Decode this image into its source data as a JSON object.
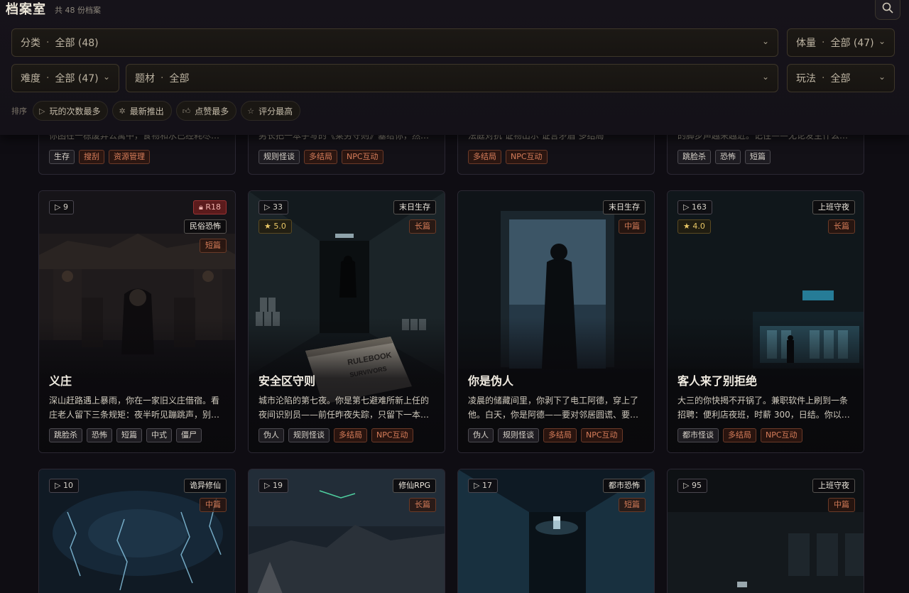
{
  "header": {
    "title": "档案室",
    "count": "共 48 份档案",
    "search_icon": "search-icon"
  },
  "filters": {
    "category": {
      "label": "分类",
      "value": "全部 (48)"
    },
    "volume": {
      "label": "体量",
      "value": "全部 (47)"
    },
    "difficulty": {
      "label": "难度",
      "value": "全部 (47)"
    },
    "theme": {
      "label": "题材",
      "value": "全部"
    },
    "gameplay": {
      "label": "玩法",
      "value": "全部"
    },
    "separator": "·"
  },
  "sort": {
    "label": "排序",
    "options": [
      {
        "label": "玩的次数最多",
        "icon": "play-icon"
      },
      {
        "label": "最新推出",
        "icon": "sparkle-icon"
      },
      {
        "label": "点赞最多",
        "icon": "thumb-up-icon"
      },
      {
        "label": "评分最高",
        "icon": "star-icon"
      }
    ]
  },
  "top_row": [
    {
      "desc_fragment": "你困在一栋废弃公寓中，食物和水已经耗尽…",
      "tags": [
        "生存",
        "搜刮",
        "资源管理"
      ],
      "warm": [
        false,
        true,
        true
      ]
    },
    {
      "desc_fragment": "男长把一本手写的《莱劳守则》塞给你，然…",
      "tags": [
        "规则怪谈",
        "多结局",
        "NPC互动"
      ],
      "warm": [
        false,
        true,
        true
      ]
    },
    {
      "desc_fragment": "法庭对抗  证物出示  证言矛盾  多结局",
      "tags": [
        "多结局",
        "NPC互动"
      ],
      "warm": [
        true,
        true
      ]
    },
    {
      "desc_fragment": "的脚步声越来越近。记住——无论发生什么…",
      "tags": [
        "跳脸杀",
        "恐怖",
        "短篇"
      ],
      "warm": [
        false,
        false,
        false
      ]
    }
  ],
  "cards": [
    {
      "plays": "9",
      "r18": "R18",
      "rating": null,
      "genre": "民俗恐怖",
      "length": "短篇",
      "title": "义庄",
      "desc": "深山赶路遇上暴雨，你在一家旧义庄借宿。看庄老人留下三条规矩：夜半听见蹦跳声，别…",
      "tags": [
        "跳脸杀",
        "恐怖",
        "短篇",
        "中式",
        "僵尸"
      ],
      "warm": [
        false,
        false,
        false,
        false,
        false
      ],
      "art": "temple"
    },
    {
      "plays": "33",
      "r18": null,
      "rating": "5.0",
      "genre": "末日生存",
      "length": "长篇",
      "title": "安全区守则",
      "desc": "城市沦陷的第七夜。你是第七避难所新上任的夜间识别员——前任昨夜失踪，只留下一本…",
      "tags": [
        "伪人",
        "规则怪谈",
        "多结局",
        "NPC互动"
      ],
      "warm": [
        false,
        false,
        true,
        true
      ],
      "art": "corridor"
    },
    {
      "plays": null,
      "r18": null,
      "rating": null,
      "genre": "末日生存",
      "length": "中篇",
      "title": "你是伪人",
      "desc": "凌晨的储藏间里，你剥下了电工阿德，穿上了他。白天，你是阿德——要对邻居圆谎、要…",
      "tags": [
        "伪人",
        "规则怪谈",
        "多结局",
        "NPC互动"
      ],
      "warm": [
        false,
        false,
        true,
        true
      ],
      "art": "doorway"
    },
    {
      "plays": "163",
      "r18": null,
      "rating": "4.0",
      "genre": "上班守夜",
      "length": "长篇",
      "title": "客人来了别拒绝",
      "desc": "大三的你快揭不开锅了。兼职软件上刷到一条招聘：便利店夜班，时薪 300，日结。你以…",
      "tags": [
        "都市怪谈",
        "多结局",
        "NPC互动"
      ],
      "warm": [
        false,
        true,
        true
      ],
      "art": "store"
    }
  ],
  "bottom_row": [
    {
      "plays": "10",
      "genre": "诡异修仙",
      "length": "中篇",
      "art": "lightning"
    },
    {
      "plays": "19",
      "genre": "修仙RPG",
      "length": "长篇",
      "art": "mountain"
    },
    {
      "plays": "17",
      "genre": "都市恐怖",
      "length": "短篇",
      "art": "hallway"
    },
    {
      "plays": "95",
      "genre": "上班守夜",
      "length": "中篇",
      "art": "dark"
    }
  ],
  "colors": {
    "accent": "#d77d5a",
    "rating": "#e9c766",
    "r18": "#9c3334"
  }
}
